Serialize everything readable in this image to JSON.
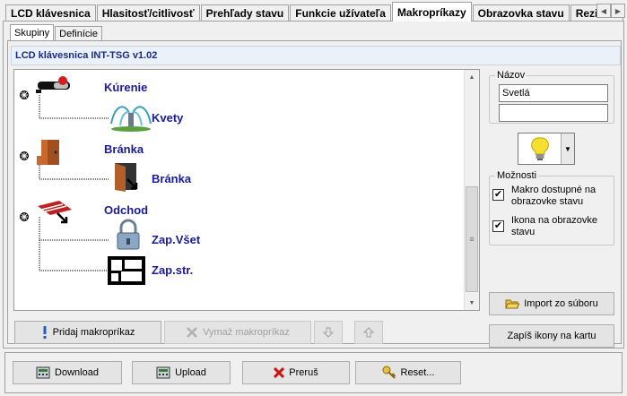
{
  "main_tabs": [
    {
      "label": "LCD klávesnica",
      "active": false
    },
    {
      "label": "Hlasitosť/citlivosť",
      "active": false
    },
    {
      "label": "Prehľady stavu",
      "active": false
    },
    {
      "label": "Funkcie užívateľa",
      "active": false
    },
    {
      "label": "Makropríkazy",
      "active": true
    },
    {
      "label": "Obrazovka stavu",
      "active": false
    },
    {
      "label": "Rezistor",
      "active": false
    }
  ],
  "sub_tabs": [
    {
      "label": "Skupiny",
      "active": true
    },
    {
      "label": "Definície",
      "active": false
    }
  ],
  "device_title": "LCD klávesnica INT-TSG v1.02",
  "tree": {
    "groups": [
      {
        "label": "Kúrenie",
        "icon": "thermostat-icon",
        "children": [
          {
            "label": "Kvety",
            "icon": "sprinkler-icon"
          }
        ]
      },
      {
        "label": "Bránka",
        "icon": "door-icon",
        "children": [
          {
            "label": "Bránka",
            "icon": "door-open-icon"
          }
        ]
      },
      {
        "label": "Odchod",
        "icon": "awning-icon",
        "children": [
          {
            "label": "Zap.Všet",
            "icon": "padlock-icon"
          },
          {
            "label": "Zap.str.",
            "icon": "floorplan-icon"
          }
        ]
      }
    ]
  },
  "name_group": {
    "title": "Názov",
    "line1": "Svetlá",
    "line2": ""
  },
  "selected_icon": "light-bulb-icon",
  "options_group": {
    "title": "Možnosti",
    "opt1": {
      "label": "Makro dostupné na obrazovke stavu",
      "checked": true
    },
    "opt2": {
      "label": "Ikona na obrazovke stavu",
      "checked": true
    }
  },
  "buttons": {
    "add_macro": "Pridaj makropríkaz",
    "delete_macro": "Vymaž makropríkaz",
    "import_file": "Import zo súboru",
    "write_icons": "Zapíš ikony na kartu",
    "download": "Download",
    "upload": "Upload",
    "abort": "Preruš",
    "reset": "Reset..."
  },
  "colors": {
    "tree_label": "#1a1a9a",
    "device_title": "#1a2a8a"
  }
}
